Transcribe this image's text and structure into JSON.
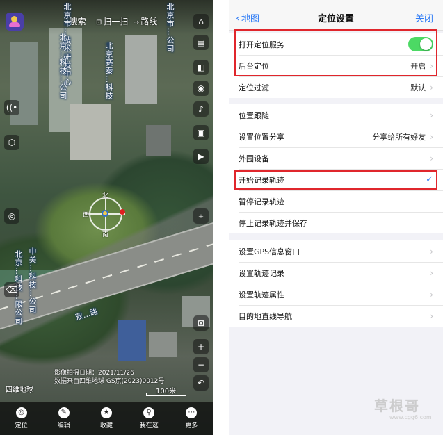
{
  "map": {
    "top_tabs": [
      {
        "icon": "search-icon",
        "label": "搜索"
      },
      {
        "icon": "scan-icon",
        "label": "扫一扫"
      },
      {
        "icon": "route-icon",
        "label": "路线"
      }
    ],
    "place_labels": [
      "北京市…技术研发中心",
      "北京市…公司",
      "北京…科技…公司",
      "北京赛泰…科技",
      "中关…科技…公司",
      "北京…科技…限公司"
    ],
    "road_label": "双…路",
    "compass": {
      "north": "北",
      "west": "西",
      "south": "南"
    },
    "capture_date": "影像拍摄日期：2021/11/26",
    "data_source": "数据来自四维地球 GS京(2023)0012号",
    "earth_logo": "四维地球",
    "scale": "100米",
    "bottom_nav": [
      {
        "icon": "locate-icon",
        "label": "定位"
      },
      {
        "icon": "edit-icon",
        "label": "编辑"
      },
      {
        "icon": "star-icon",
        "label": "收藏"
      },
      {
        "icon": "pin-icon",
        "label": "我在这"
      },
      {
        "icon": "more-icon",
        "label": "更多"
      }
    ]
  },
  "settings": {
    "back_label": "地图",
    "title": "定位设置",
    "close_label": "关闭",
    "group1": [
      {
        "label": "打开定位服务",
        "toggle": true
      },
      {
        "label": "后台定位",
        "value": "开启"
      },
      {
        "label": "定位过滤",
        "value": "默认"
      }
    ],
    "group2": [
      {
        "label": "位置跟随"
      },
      {
        "label": "设置位置分享",
        "value": "分享给所有好友"
      },
      {
        "label": "外围设备"
      },
      {
        "label": "开始记录轨迹",
        "checked": true
      },
      {
        "label": "暂停记录轨迹"
      },
      {
        "label": "停止记录轨迹并保存"
      }
    ],
    "group3": [
      {
        "label": "设置GPS信息窗口"
      },
      {
        "label": "设置轨迹记录"
      },
      {
        "label": "设置轨迹属性"
      },
      {
        "label": "目的地直线导航"
      }
    ]
  },
  "watermark": {
    "text": "草根哥",
    "sub": "www.cgg6.com"
  },
  "colors": {
    "accent": "#2f7cf6",
    "toggle_on": "#4cd964",
    "highlight": "#e0262c"
  }
}
